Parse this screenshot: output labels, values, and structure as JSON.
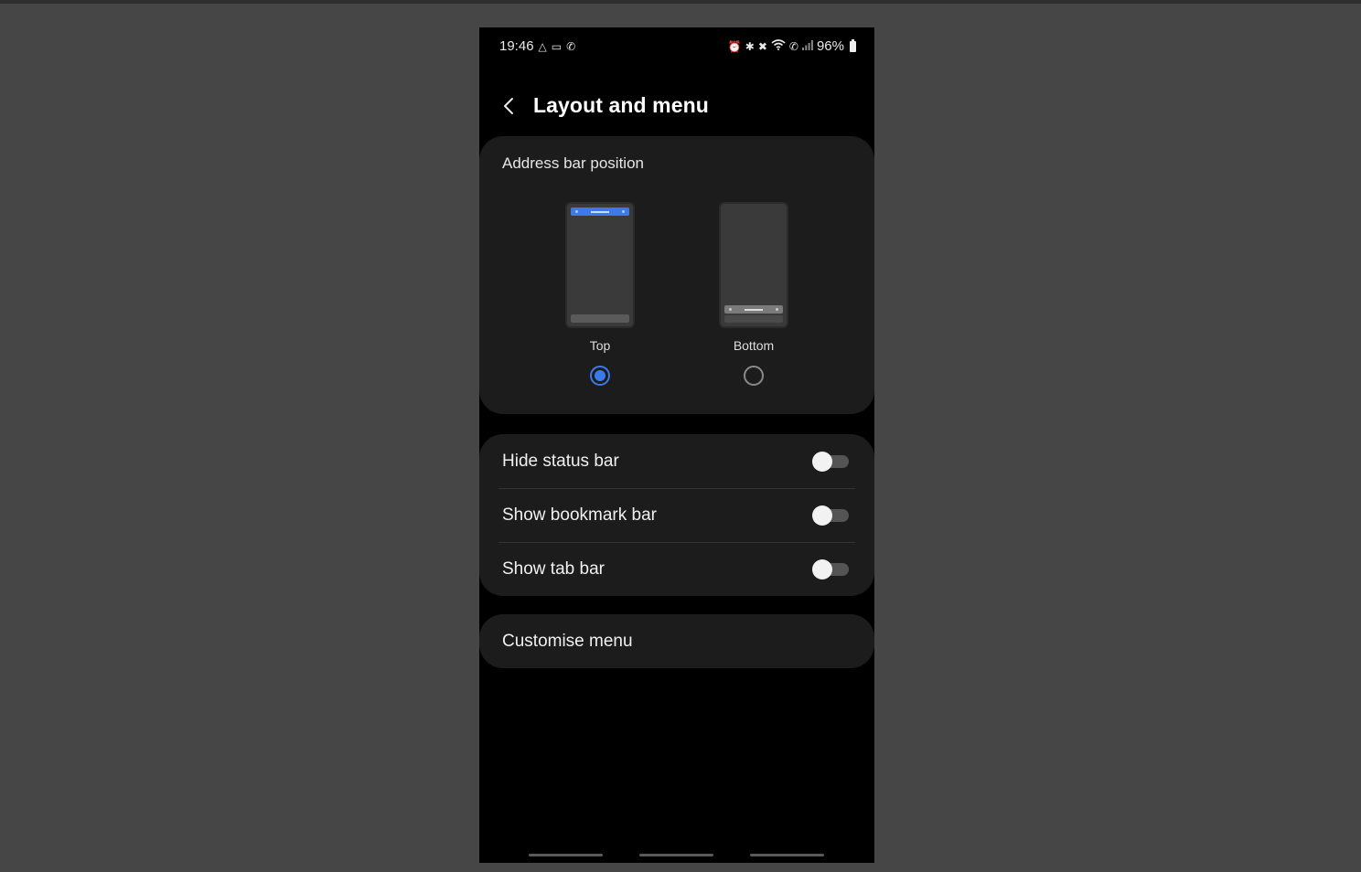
{
  "status_bar": {
    "time": "19:46",
    "left_icons": [
      "accessibility-icon",
      "cast-icon",
      "wifi-call-icon"
    ],
    "right_icons": [
      "alarm-icon",
      "bluetooth-icon",
      "mute-icon",
      "wifi-icon",
      "volte-icon",
      "signal-icon"
    ],
    "battery": "96%"
  },
  "header": {
    "title": "Layout and menu"
  },
  "address_bar": {
    "section_title": "Address bar position",
    "options": [
      {
        "label": "Top",
        "selected": true
      },
      {
        "label": "Bottom",
        "selected": false
      }
    ],
    "accent_color": "#3b7ae8"
  },
  "toggles": [
    {
      "label": "Hide status bar",
      "on": false
    },
    {
      "label": "Show bookmark bar",
      "on": false
    },
    {
      "label": "Show tab bar",
      "on": false
    }
  ],
  "menu": {
    "customise_label": "Customise menu"
  },
  "nav_bar": [
    "recents-button",
    "home-button",
    "back-gesture-button"
  ]
}
